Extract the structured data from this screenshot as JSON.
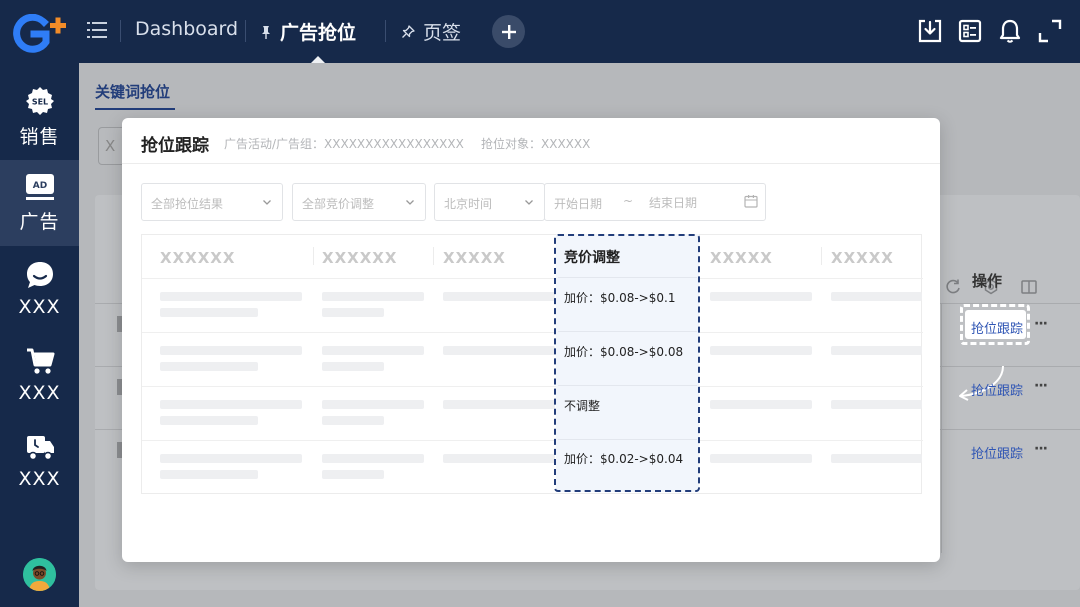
{
  "topbar": {
    "dashboard_label": "Dashboard",
    "active_tab_label": "广告抢位",
    "bookmark_label": "页签"
  },
  "sidebar": {
    "items": [
      {
        "icon": "sel-badge-icon",
        "label": "销售",
        "badge": "SEL"
      },
      {
        "icon": "ad-badge-icon",
        "label": "广告",
        "badge": "AD",
        "active": true
      },
      {
        "icon": "chat-bubble-icon",
        "label": "XXX"
      },
      {
        "icon": "cart-icon",
        "label": "XXX"
      },
      {
        "icon": "truck-icon",
        "label": "XXX"
      }
    ]
  },
  "background": {
    "subtab_label": "关键词抢位",
    "input_hint": "X",
    "ops_header": "操作",
    "track_link": "抢位跟踪",
    "more": "···"
  },
  "modal": {
    "title": "抢位跟踪",
    "subtitle_campaign": "广告活动/广告组：XXXXXXXXXXXXXXXXX",
    "subtitle_target": "抢位对象：XXXXXX",
    "filters": {
      "result": "全部抢位结果",
      "adjust": "全部竞价调整",
      "timezone": "北京时间",
      "start_date": "开始日期",
      "date_sep": "~",
      "end_date": "结束日期"
    },
    "table": {
      "headers": [
        "XXXXXX",
        "XXXXXX",
        "XXXXX",
        "竞价调整",
        "XXXXX",
        "XXXXX"
      ],
      "bid_adjustments": [
        "加价：$0.08->$0.1",
        "加价：$0.08->$0.08",
        "不调整",
        "加价：$0.02->$0.04"
      ]
    }
  },
  "colors": {
    "sidebar_bg": "#16294a",
    "accent": "#223d7a",
    "link": "#2f55b4"
  }
}
